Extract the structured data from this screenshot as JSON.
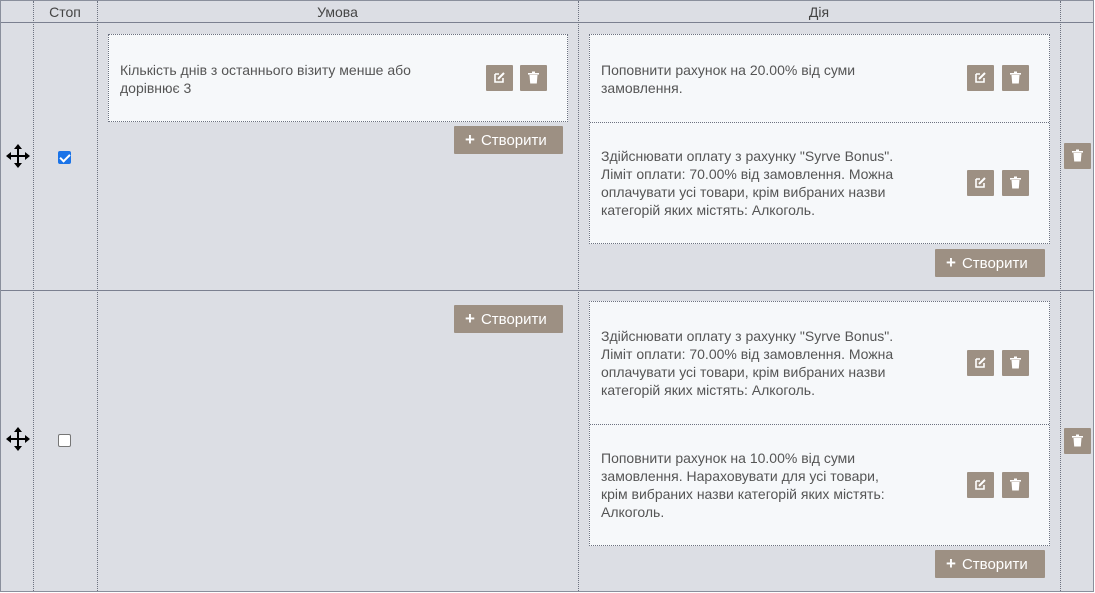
{
  "header": {
    "stop": "Стоп",
    "condition": "Умова",
    "action": "Дія"
  },
  "create_label": "Створити",
  "icons": {
    "drag": "move-arrows-icon",
    "edit": "edit-icon",
    "delete": "trash-icon",
    "add": "plus-icon"
  },
  "colors": {
    "button": "#9d9083",
    "grid_bg": "#dcdee4",
    "card_bg": "#f6f8fa",
    "checkbox": "#1a73e8"
  },
  "rules": [
    {
      "stop_checked": true,
      "conditions": [
        {
          "text": "Кількість днів з останнього візиту менше або дорівнює 3"
        }
      ],
      "actions": [
        {
          "text": "Поповнити рахунок на 20.00% від суми замовлення."
        },
        {
          "text": "Здійснювати оплату з рахунку \"Syrve Bonus\". Ліміт оплати: 70.00% від замовлення. Можна оплачувати усі товари, крім вибраних назви категорій яких містять: Алкоголь."
        }
      ]
    },
    {
      "stop_checked": false,
      "conditions": [],
      "actions": [
        {
          "text": "Здійснювати оплату з рахунку \"Syrve Bonus\". Ліміт оплати: 70.00% від замовлення. Можна оплачувати усі товари, крім вибраних назви категорій яких містять: Алкоголь."
        },
        {
          "text": "Поповнити рахунок на 10.00% від суми замовлення. Нараховувати для усі товари, крім вибраних назви категорій яких містять: Алкоголь."
        }
      ]
    }
  ]
}
